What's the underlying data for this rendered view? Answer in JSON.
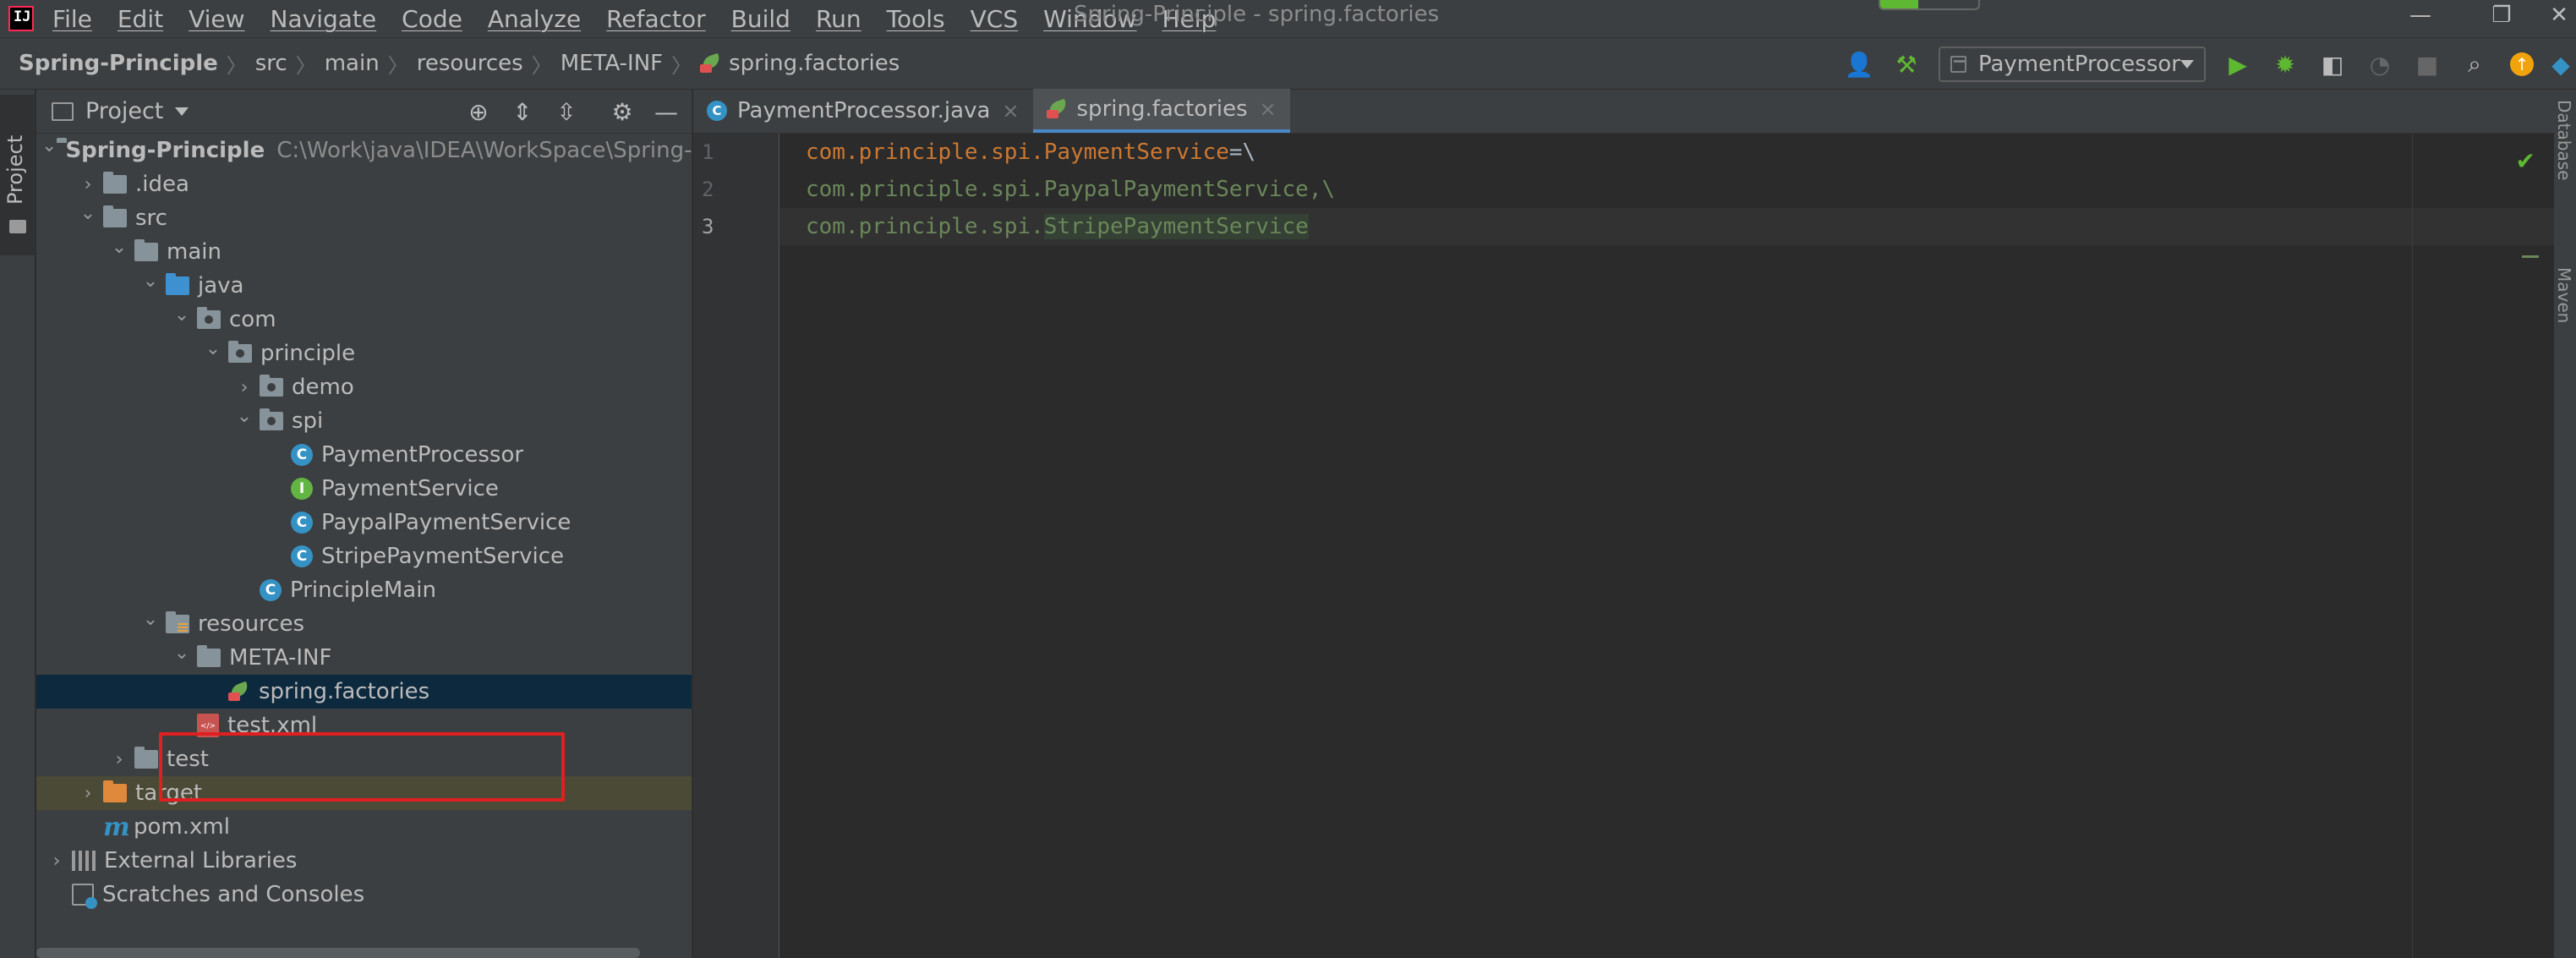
{
  "menu": {
    "items": [
      "File",
      "Edit",
      "View",
      "Navigate",
      "Code",
      "Analyze",
      "Refactor",
      "Build",
      "Run",
      "Tools",
      "VCS",
      "Window",
      "Help"
    ],
    "window_title": "Spring-Principle - spring.factories"
  },
  "breadcrumb": {
    "items": [
      "Spring-Principle",
      "src",
      "main",
      "resources",
      "META-INF",
      "spring.factories"
    ]
  },
  "toolbar": {
    "run_config": "PaymentProcessor"
  },
  "left_strip": {
    "project_tab": "Project"
  },
  "project_panel": {
    "title": "Project",
    "tree": [
      {
        "label": "Spring-Principle",
        "path": "C:\\Work\\java\\IDEA\\WorkSpace\\Spring-Prin",
        "icon": "module-folder-icon",
        "depth": 0,
        "expanded": true
      },
      {
        "label": ".idea",
        "icon": "folder-icon",
        "depth": 1,
        "expanded": false
      },
      {
        "label": "src",
        "icon": "folder-icon",
        "depth": 1,
        "expanded": true
      },
      {
        "label": "main",
        "icon": "folder-icon",
        "depth": 2,
        "expanded": true
      },
      {
        "label": "java",
        "icon": "source-folder-icon",
        "depth": 3,
        "expanded": true
      },
      {
        "label": "com",
        "icon": "package-icon",
        "depth": 4,
        "expanded": true
      },
      {
        "label": "principle",
        "icon": "package-icon",
        "depth": 5,
        "expanded": true
      },
      {
        "label": "demo",
        "icon": "package-icon",
        "depth": 6,
        "expanded": false
      },
      {
        "label": "spi",
        "icon": "package-icon",
        "depth": 6,
        "expanded": true
      },
      {
        "label": "PaymentProcessor",
        "icon": "class-icon",
        "depth": 7
      },
      {
        "label": "PaymentService",
        "icon": "interface-icon",
        "depth": 7
      },
      {
        "label": "PaypalPaymentService",
        "icon": "class-icon",
        "depth": 7
      },
      {
        "label": "StripePaymentService",
        "icon": "class-icon",
        "depth": 7
      },
      {
        "label": "PrincipleMain",
        "icon": "class-icon",
        "depth": 6
      },
      {
        "label": "resources",
        "icon": "resources-folder-icon",
        "depth": 3,
        "expanded": true
      },
      {
        "label": "META-INF",
        "icon": "folder-icon",
        "depth": 4,
        "expanded": true
      },
      {
        "label": "spring.factories",
        "icon": "spring-icon",
        "depth": 5,
        "selected": true
      },
      {
        "label": "test.xml",
        "icon": "xml-icon",
        "depth": 4
      },
      {
        "label": "test",
        "icon": "folder-icon",
        "depth": 2,
        "expanded": false
      },
      {
        "label": "target",
        "icon": "excluded-folder-icon",
        "depth": 1,
        "expanded": false,
        "excluded": true
      },
      {
        "label": "pom.xml",
        "icon": "maven-icon",
        "depth": 1
      },
      {
        "label": "External Libraries",
        "icon": "libraries-icon",
        "depth": 0,
        "expanded": false
      },
      {
        "label": "Scratches and Consoles",
        "icon": "scratches-icon",
        "depth": 0
      }
    ]
  },
  "editor": {
    "tabs": [
      {
        "label": "PaymentProcessor.java",
        "active": false
      },
      {
        "label": "spring.factories",
        "active": true
      }
    ],
    "lines": [
      {
        "num": "1",
        "key": "com.principle.spi.PaymentService",
        "sep": "=\\"
      },
      {
        "num": "2",
        "value": "com.principle.spi.PaypalPaymentService,\\"
      },
      {
        "num": "3",
        "prefix": "com.principle.spi.",
        "match": "StripePaymentService"
      }
    ]
  },
  "colors": {
    "background": "#2b2b2b",
    "panel": "#3c3f41",
    "selection": "#0d293e",
    "highlight_box": "#e02020",
    "key": "#cc7832",
    "value": "#6a8759"
  }
}
